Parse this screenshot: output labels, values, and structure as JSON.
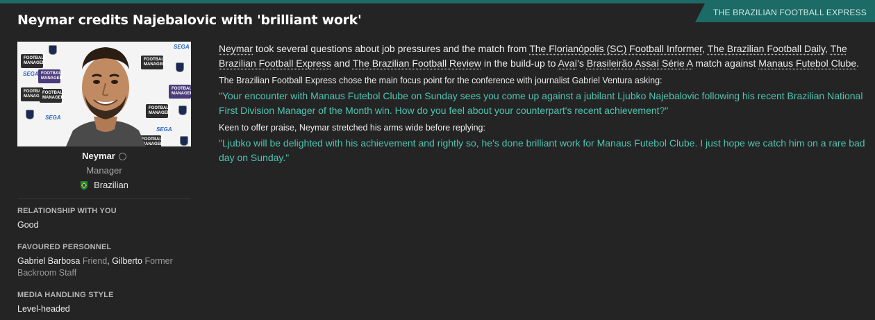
{
  "source_tag": "THE BRAZILIAN FOOTBALL EXPRESS",
  "headline": "Neymar credits Najebalovic with 'brilliant work'",
  "photo": {
    "logo_text": "FOOTBALL MANAGER",
    "sega_text": "SEGA"
  },
  "person": {
    "name": "Neymar",
    "role": "Manager",
    "nationality": "Brazilian"
  },
  "colors": {
    "accent": "#1d6b66",
    "quote": "#4fc4b2",
    "background": "#242424"
  },
  "info_sections": [
    {
      "title": "RELATIONSHIP WITH YOU",
      "value": "Good"
    },
    {
      "title": "FAVOURED PERSONNEL",
      "p1_name": "Gabriel Barbosa",
      "p1_role": "Friend",
      "sep": ", ",
      "p2_name": "Gilberto",
      "p2_role": "Former Backroom Staff"
    },
    {
      "title": "MEDIA HANDLING STYLE",
      "value": "Level-headed"
    }
  ],
  "intro": {
    "t0": "Neymar",
    "t1": " took several questions about job pressures and the match from ",
    "t2": "The Florianópolis (SC) Football Informer",
    "t3": ", ",
    "t4": "The Brazilian Football Daily",
    "t5": ", ",
    "t6": "The Brazilian Football Express",
    "t7": " and ",
    "t8": "The Brazilian Football Review",
    "t9": " in the build-up to ",
    "t10": "Avaí",
    "t11": "'s ",
    "t12": "Brasileirão Assaí Série A",
    "t13": " match against ",
    "t14": "Manaus Futebol Clube",
    "t15": "."
  },
  "focus_line": "The Brazilian Football Express chose the main focus point for the conference with journalist Gabriel Ventura asking:",
  "question": "\"Your encounter with Manaus Futebol Clube on Sunday sees you come up against a jubilant Ljubko Najebalovic following his recent Brazilian National First Division Manager of the Month win. How do you feel about your counterpart's recent achievement?\"",
  "reply_intro": "Keen to offer praise, Neymar stretched his arms wide before replying:",
  "answer": "\"Ljubko will be delighted with his achievement and rightly so, he's done brilliant work for Manaus Futebol Clube. I just hope we catch him on a rare bad day on Sunday.\""
}
